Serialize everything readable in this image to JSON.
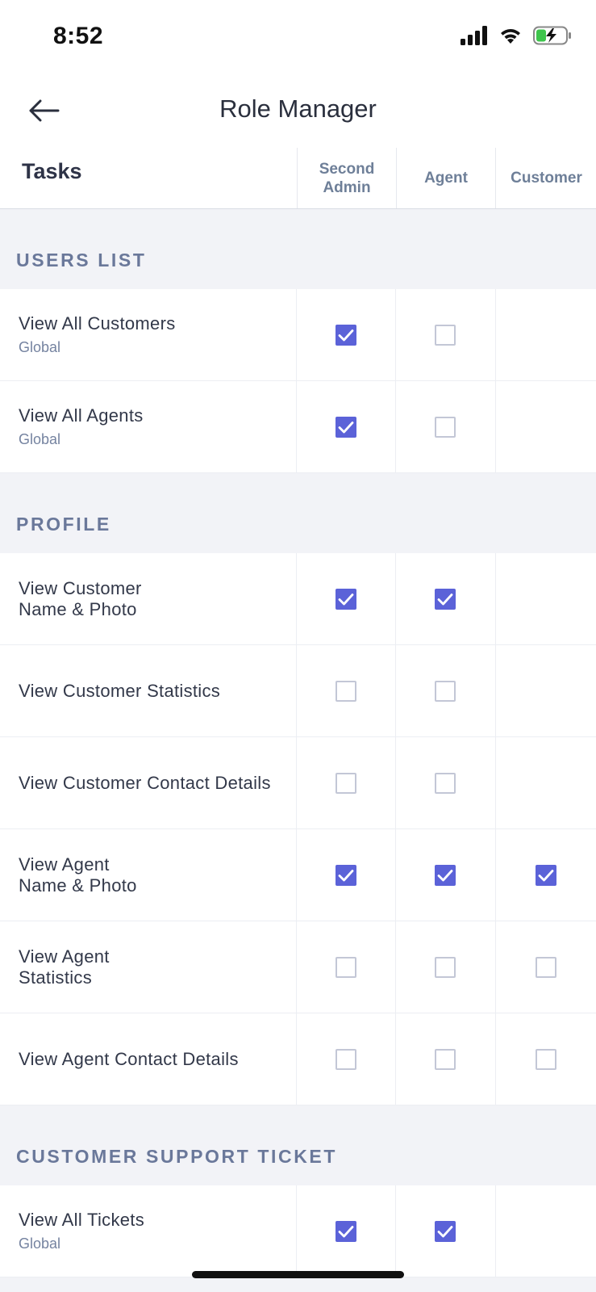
{
  "status": {
    "time": "8:52"
  },
  "nav": {
    "title": "Role Manager"
  },
  "header": {
    "tasks_label": "Tasks",
    "columns": [
      "Second\nAdmin",
      "Agent",
      "Customer"
    ]
  },
  "sections": [
    {
      "title": "USERS LIST",
      "rows": [
        {
          "name": "View All Customers",
          "scope": "Global",
          "cells": [
            true,
            false,
            null
          ]
        },
        {
          "name": "View All Agents",
          "scope": "Global",
          "cells": [
            true,
            false,
            null
          ]
        }
      ]
    },
    {
      "title": "PROFILE",
      "rows": [
        {
          "name": "View Customer\nName & Photo",
          "scope": "",
          "cells": [
            true,
            true,
            null
          ]
        },
        {
          "name": "View Customer Statistics",
          "scope": "",
          "cells": [
            false,
            false,
            null
          ]
        },
        {
          "name": "View Customer Contact Details",
          "scope": "",
          "cells": [
            false,
            false,
            null
          ]
        },
        {
          "name": "View Agent\nName & Photo",
          "scope": "",
          "cells": [
            true,
            true,
            true
          ]
        },
        {
          "name": "View Agent\nStatistics",
          "scope": "",
          "cells": [
            false,
            false,
            false
          ]
        },
        {
          "name": "View Agent Contact Details",
          "scope": "",
          "cells": [
            false,
            false,
            false
          ]
        }
      ]
    },
    {
      "title": "CUSTOMER SUPPORT TICKET",
      "rows": [
        {
          "name": "View All Tickets",
          "scope": "Global",
          "cells": [
            true,
            true,
            null
          ]
        }
      ]
    }
  ],
  "colors": {
    "accent": "#5b62d8",
    "unchecked_border": "#c3c7d6",
    "section_text": "#6a789a"
  },
  "icons": {
    "back": "arrow-left-icon",
    "signal": "cellular-signal-icon",
    "wifi": "wifi-icon",
    "battery": "battery-charging-icon",
    "check": "checkmark-icon"
  }
}
